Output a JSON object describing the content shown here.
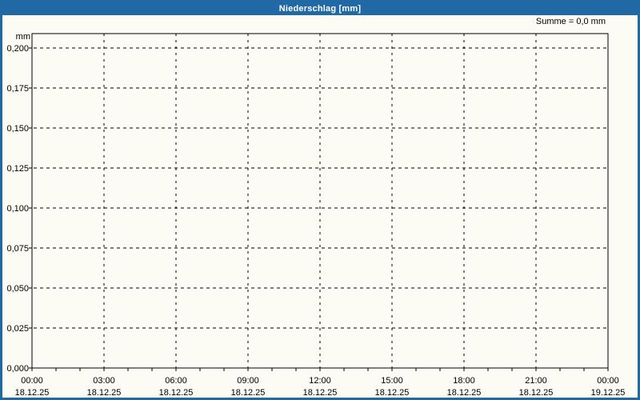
{
  "window": {
    "title": "Niederschlag [mm]"
  },
  "annotation": {
    "sum_label": "Summe = 0,0 mm"
  },
  "chart_data": {
    "type": "line",
    "title": "Niederschlag [mm]",
    "ylabel": "mm",
    "sum_annotation": "Summe = 0,0 mm",
    "ylim": [
      0,
      0.2
    ],
    "y_ticks": [
      {
        "label": "0,200",
        "value": 0.2
      },
      {
        "label": "0,175",
        "value": 0.175
      },
      {
        "label": "0,150",
        "value": 0.15
      },
      {
        "label": "0,125",
        "value": 0.125
      },
      {
        "label": "0,100",
        "value": 0.1
      },
      {
        "label": "0,075",
        "value": 0.075
      },
      {
        "label": "0,050",
        "value": 0.05
      },
      {
        "label": "0,025",
        "value": 0.025
      },
      {
        "label": "0,000",
        "value": 0.0
      }
    ],
    "xlim_hours": [
      0,
      24
    ],
    "x_minor_step_hours": 1,
    "x_ticks": [
      {
        "hour": 0,
        "time": "00:00",
        "date": "18.12.25"
      },
      {
        "hour": 3,
        "time": "03:00",
        "date": "18.12.25"
      },
      {
        "hour": 6,
        "time": "06:00",
        "date": "18.12.25"
      },
      {
        "hour": 9,
        "time": "09:00",
        "date": "18.12.25"
      },
      {
        "hour": 12,
        "time": "12:00",
        "date": "18.12.25"
      },
      {
        "hour": 15,
        "time": "15:00",
        "date": "18.12.25"
      },
      {
        "hour": 18,
        "time": "18:00",
        "date": "18.12.25"
      },
      {
        "hour": 21,
        "time": "21:00",
        "date": "18.12.25"
      },
      {
        "hour": 24,
        "time": "00:00",
        "date": "19.12.25"
      }
    ],
    "grid": "dashed",
    "legend": "none",
    "series": [
      {
        "name": "Niederschlag",
        "values": []
      }
    ]
  },
  "colors": {
    "titlebar": "#2169A4",
    "border": "#2169A4",
    "title_text": "#FFFFFF",
    "background": "#FCFCF4",
    "grid": "#000000",
    "axis": "#000000",
    "text": "#000000"
  }
}
